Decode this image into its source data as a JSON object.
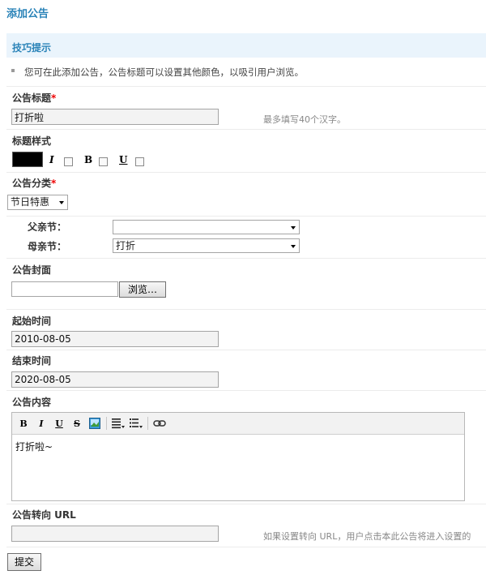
{
  "page": {
    "title": "添加公告",
    "tips_title": "技巧提示",
    "tip": "您可在此添加公告，公告标题可以设置其他颜色，以吸引用户浏览。"
  },
  "form": {
    "title_label": "公告标题",
    "title_value": "打折啦",
    "title_hint": "最多填写40个汉字。",
    "style_label": "标题样式",
    "style_color": "#000000",
    "style_italic": "I",
    "style_bold": "B",
    "style_underline": "U",
    "category_label": "公告分类",
    "category_value": "节日特惠",
    "parent_label": "父亲节：",
    "parent_value": "",
    "mother_label": "母亲节：",
    "mother_value": "打折",
    "cover_label": "公告封面",
    "cover_value": "",
    "browse_label": "浏览…",
    "start_label": "起始时间",
    "start_value": "2010-08-05",
    "end_label": "结束时间",
    "end_value": "2020-08-05",
    "content_label": "公告内容",
    "content_value": "打折啦~",
    "url_label": "公告转向 URL",
    "url_value": "",
    "url_hint": "如果设置转向 URL，用户点击本此公告将进入设置的",
    "submit_label": "提交",
    "required_mark": "*"
  },
  "editor_toolbar": {
    "bold": "B",
    "italic": "I",
    "underline": "U",
    "strike": "S",
    "icons": [
      "image-icon",
      "align-icon",
      "list-icon",
      "link-icon"
    ]
  }
}
